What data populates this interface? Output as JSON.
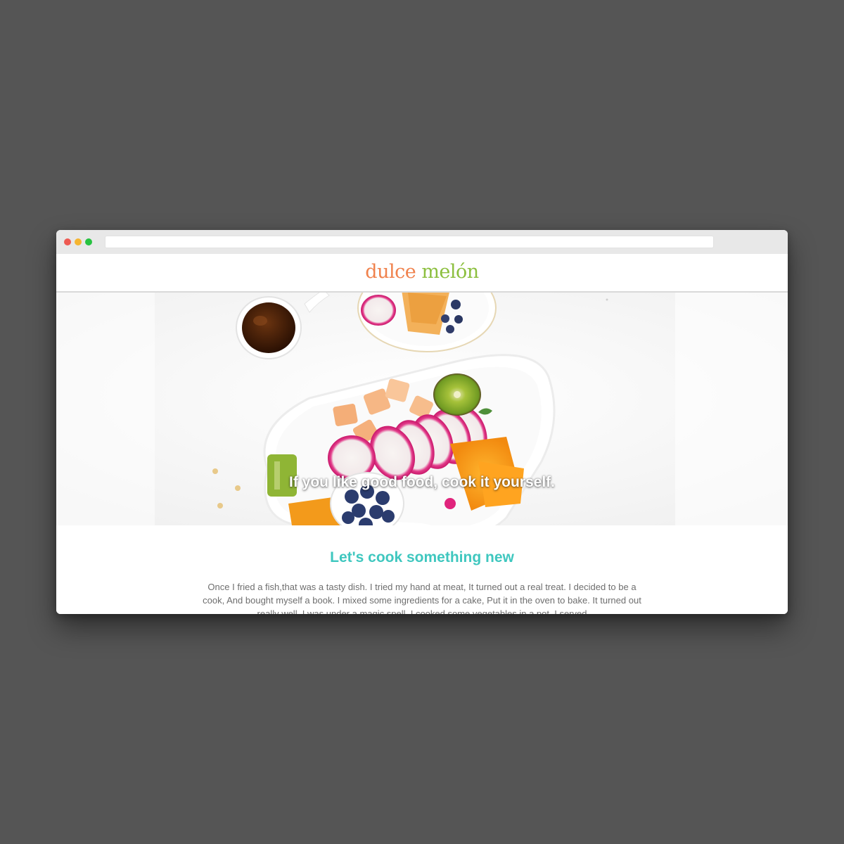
{
  "site": {
    "logo_part1": "dulce",
    "logo_part2": "melón",
    "brand_colors": {
      "logo_orange": "#f0824d",
      "logo_green": "#8cbf3f",
      "accent_teal": "#3fc7bf"
    }
  },
  "hero": {
    "tagline": "If you like good food, cook it yourself.",
    "image_subject": "fruit-platter-photo"
  },
  "main": {
    "title": "Let's cook something new",
    "body": "Once I fried a fish,that was a tasty dish. I tried my hand at meat, It turned out a real treat. I decided to be a cook, And bought myself a book. I mixed some ingredients for a cake, Put it in the oven to bake. It turned out really well, I was under a magic spell. I cooked some vegetables in a pot, I served"
  },
  "window": {
    "controls": [
      "close",
      "minimize",
      "maximize"
    ]
  }
}
